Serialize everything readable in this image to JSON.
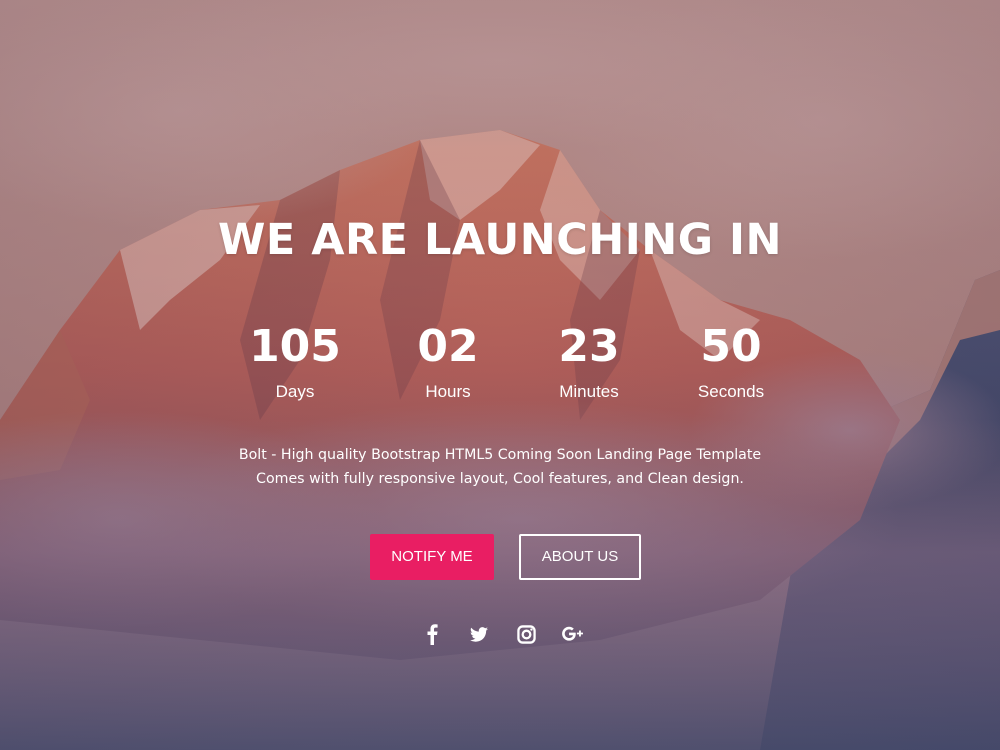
{
  "hero": {
    "headline": "WE ARE LAUNCHING IN"
  },
  "countdown": [
    {
      "value": "105",
      "label": "Days"
    },
    {
      "value": "02",
      "label": "Hours"
    },
    {
      "value": "23",
      "label": "Minutes"
    },
    {
      "value": "50",
      "label": "Seconds"
    }
  ],
  "description": {
    "line1": "Bolt - High quality Bootstrap HTML5 Coming Soon Landing Page Template",
    "line2": "Comes with fully responsive layout, Cool features, and Clean design."
  },
  "buttons": {
    "notify_label": "NOTIFY ME",
    "about_label": "ABOUT US"
  },
  "social": [
    {
      "icon": "facebook-icon"
    },
    {
      "icon": "twitter-icon"
    },
    {
      "icon": "instagram-icon"
    },
    {
      "icon": "google-plus-icon"
    }
  ],
  "colors": {
    "accent": "#e91e63",
    "text": "#ffffff"
  }
}
